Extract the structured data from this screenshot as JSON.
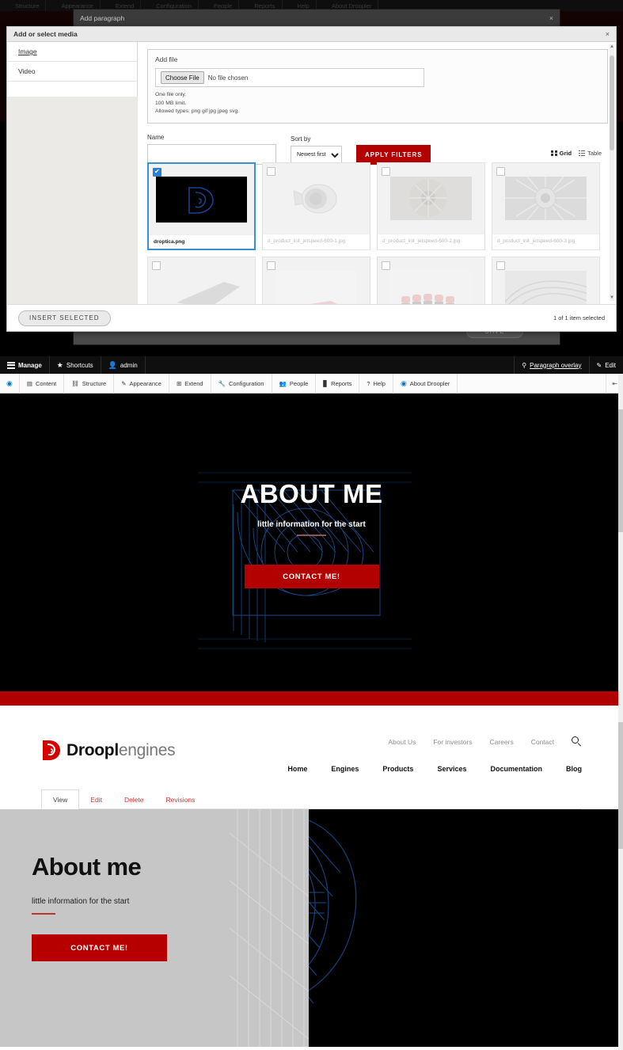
{
  "dimmed_toolbar": {
    "items": [
      {
        "label": "Structure",
        "icon": "structure-icon"
      },
      {
        "label": "Appearance",
        "icon": "paintbrush-icon"
      },
      {
        "label": "Extend",
        "icon": "extend-icon"
      },
      {
        "label": "Configuration",
        "icon": "wrench-icon"
      },
      {
        "label": "People",
        "icon": "people-icon"
      },
      {
        "label": "Reports",
        "icon": "chart-icon"
      },
      {
        "label": "Help",
        "icon": "help-icon"
      },
      {
        "label": "About Droopler",
        "icon": "droopler-icon"
      }
    ]
  },
  "paragraph_dialog": {
    "title": "Add paragraph",
    "close_label": "×",
    "save_label": "SAVE"
  },
  "media_modal": {
    "title": "Add or select media",
    "close_label": "×",
    "sidebar": [
      {
        "label": "Image",
        "active": true
      },
      {
        "label": "Video",
        "active": false
      }
    ],
    "add_file": {
      "legend": "Add file",
      "choose_button": "Choose File",
      "no_file_text": "No file chosen",
      "notes": [
        "One file only.",
        "100 MB limit.",
        "Allowed types: png gif jpg jpeg svg."
      ]
    },
    "filters": {
      "name_label": "Name",
      "name_value": "",
      "name_placeholder": "",
      "sort_label": "Sort by",
      "sort_value": "Newest first",
      "sort_options": [
        "Newest first"
      ],
      "apply_label": "APPLY FILTERS"
    },
    "view_toggle": {
      "grid_label": "Grid",
      "table_label": "Table",
      "selected": "Grid"
    },
    "items": [
      {
        "name": "droptica.png",
        "selected": true,
        "thumb": "droptica-logo"
      },
      {
        "name": "d_product_init_jetspeed-600-1.jpg",
        "selected": false,
        "thumb": "engine-nacelle"
      },
      {
        "name": "d_product_init_jetspeed-600-2.jpg",
        "selected": false,
        "thumb": "engine-fan-angle"
      },
      {
        "name": "d_product_init_jetspeed-600-3.jpg",
        "selected": false,
        "thumb": "engine-fan-front"
      },
      {
        "name": "",
        "selected": false,
        "thumb": "wing-gray"
      },
      {
        "name": "",
        "selected": false,
        "thumb": "plane-red"
      },
      {
        "name": "",
        "selected": false,
        "thumb": "seats-red"
      },
      {
        "name": "",
        "selected": false,
        "thumb": "turbine-gray"
      }
    ],
    "footer": {
      "insert_label": "INSERT SELECTED",
      "selection_status": "1 of 1 item selected"
    }
  },
  "admin_toolbar": {
    "manage": "Manage",
    "shortcuts": "Shortcuts",
    "user": "admin",
    "paragraph_overlay": "Paragraph overlay",
    "edit": "Edit",
    "menu": [
      {
        "label": "Content",
        "icon": "content-icon"
      },
      {
        "label": "Structure",
        "icon": "structure-icon"
      },
      {
        "label": "Appearance",
        "icon": "paintbrush-icon"
      },
      {
        "label": "Extend",
        "icon": "extend-icon"
      },
      {
        "label": "Configuration",
        "icon": "wrench-icon"
      },
      {
        "label": "People",
        "icon": "people-icon"
      },
      {
        "label": "Reports",
        "icon": "chart-icon"
      },
      {
        "label": "Help",
        "icon": "help-icon"
      },
      {
        "label": "About Droopler",
        "icon": "droopler-icon"
      }
    ],
    "collapse_label": "⇤"
  },
  "hero_dark": {
    "title": "ABOUT ME",
    "subtitle": "little information for the start",
    "cta": "CONTACT ME!",
    "accent_color": "#b30000"
  },
  "site": {
    "logo": {
      "bold": "Droopl",
      "light": "engines"
    },
    "top_nav": [
      "About Us",
      "For investors",
      "Careers",
      "Contact"
    ],
    "search_icon": "search-icon",
    "main_nav": [
      "Home",
      "Engines",
      "Products",
      "Services",
      "Documentation",
      "Blog"
    ],
    "node_tabs": [
      {
        "label": "View",
        "active": true
      },
      {
        "label": "Edit",
        "active": false
      },
      {
        "label": "Delete",
        "active": false
      },
      {
        "label": "Revisions",
        "active": false
      }
    ],
    "hero": {
      "title": "About me",
      "subtitle": "little information for the start",
      "cta": "CONTACT ME!",
      "accent_color": "#b60000"
    }
  }
}
